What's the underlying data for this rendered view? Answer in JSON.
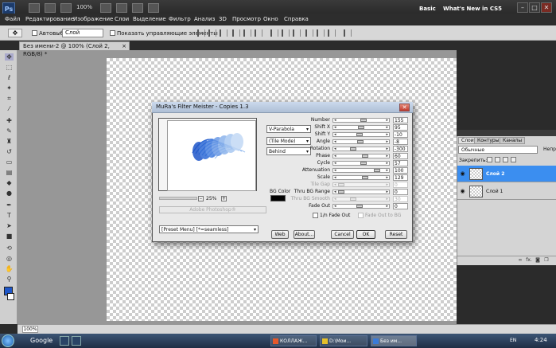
{
  "app": {
    "logo": "Ps",
    "zoom": "100%",
    "menu": [
      "Файл",
      "Редактирование",
      "Изображение",
      "Слои",
      "Выделение",
      "Фильтр",
      "Анализ",
      "3D",
      "Просмотр",
      "Окно",
      "Справка"
    ],
    "workspaces": [
      "Basic",
      "What's New in CS5"
    ],
    "window_controls": [
      "–",
      "□",
      "✕"
    ]
  },
  "options_bar": {
    "autoselect_label": "Автовыбор:",
    "layer_select": "Слой",
    "show_controls_label": "Показать управляющие элементы"
  },
  "document": {
    "tab_title": "Без имени-2 @ 100% (Слой 2, RGB/8) *",
    "tab_close": "×",
    "status_zoom": "100%"
  },
  "tools": [
    "move-icon",
    "marquee-icon",
    "lasso-icon",
    "magic-wand-icon",
    "crop-icon",
    "eyedropper-icon",
    "healing-icon",
    "brush-icon",
    "clone-stamp-icon",
    "history-brush-icon",
    "eraser-icon",
    "gradient-icon",
    "blur-icon",
    "dodge-icon",
    "pen-icon",
    "type-icon",
    "path-select-icon",
    "shape-icon",
    "3d-rotate-icon",
    "3d-camera-icon",
    "hand-icon",
    "zoom-icon"
  ],
  "colors": {
    "foreground": "#1f57c9",
    "background": "#ffffff",
    "selected_layer": "#3b8ef0"
  },
  "layers_panel": {
    "tabs": [
      "Слои",
      "Контуры",
      "Каналы"
    ],
    "blend_mode": "Обычные",
    "opacity_label": "Непр",
    "lock_label": "Закрепить:",
    "layers": [
      {
        "name": "Слой 2",
        "selected": true
      },
      {
        "name": "Слой 1",
        "selected": false
      }
    ],
    "footer_icons": [
      "link-icon",
      "fx-icon",
      "mask-icon",
      "adjustment-icon",
      "folder-icon",
      "new-layer-icon",
      "trash-icon"
    ],
    "fx_label": "fx."
  },
  "dialog": {
    "title": "MuRa's Filter Meister - Copies 1.3",
    "zoom_minus": "–",
    "zoom_value": "25%",
    "zoom_plus": "+",
    "adobe_text": "Adobe Photoshop®",
    "dropdowns": [
      "V-Parabola",
      "(Tile Mode)",
      "Behind"
    ],
    "bgcolor_label": "BG Color",
    "params": [
      {
        "label": "Number",
        "value": "155",
        "pos": 0.55,
        "disabled": false
      },
      {
        "label": "Shift X",
        "value": "95",
        "pos": 0.5,
        "disabled": false
      },
      {
        "label": "Shift Y",
        "value": "-10",
        "pos": 0.45,
        "disabled": false
      },
      {
        "label": "Angle",
        "value": "-8",
        "pos": 0.48,
        "disabled": false
      },
      {
        "label": "Rotation",
        "value": "-300",
        "pos": 0.3,
        "disabled": false
      },
      {
        "label": "Phase",
        "value": "60",
        "pos": 0.6,
        "disabled": false
      },
      {
        "label": "Cycle",
        "value": "57",
        "pos": 0.55,
        "disabled": false
      },
      {
        "label": "Attenuation",
        "value": "100",
        "pos": 0.9,
        "disabled": false
      },
      {
        "label": "Scale",
        "value": "129",
        "pos": 0.6,
        "disabled": false
      },
      {
        "label": "Tile Gap",
        "value": "0",
        "pos": 0.0,
        "disabled": true
      },
      {
        "label": "Thru BG Range",
        "value": "0",
        "pos": 0.0,
        "disabled": false
      },
      {
        "label": "Thru BG Smooth",
        "value": "30",
        "pos": 0.3,
        "disabled": true
      },
      {
        "label": "Fade Out",
        "value": "0",
        "pos": 0.45,
        "disabled": false
      }
    ],
    "fadeout_check_label": "1/n Fade Out",
    "fadeout_bg_label": "Fade Out to BG",
    "preset_select": "[Preset Menu] [*=seamless]",
    "buttons": {
      "web": "Web",
      "about": "About...",
      "cancel": "Cancel",
      "ok": "OK",
      "reset": "Reset"
    },
    "close": "✕"
  },
  "taskbar": {
    "google": "Google",
    "tasks": [
      "КОЛЛАЖ...",
      "D:\\Мои...",
      "Без им..."
    ],
    "lang": "EN",
    "clock": "4:24"
  }
}
